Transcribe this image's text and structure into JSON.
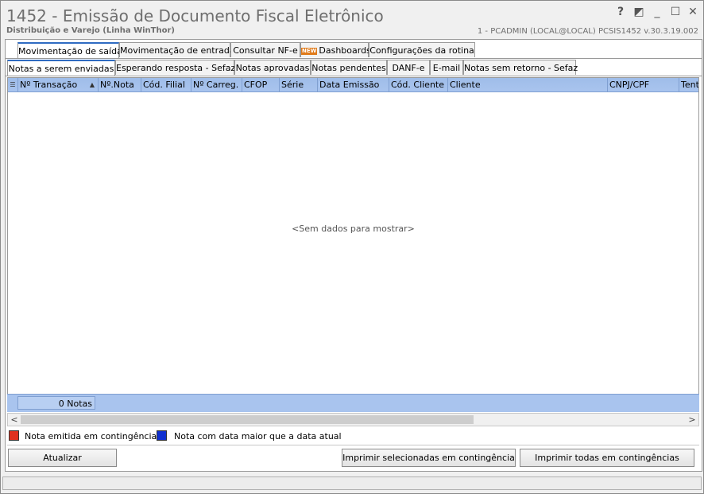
{
  "window": {
    "title": "1452 - Emissão de Documento Fiscal Eletrônico",
    "subtitle": "Distribuição e Varejo (Linha WinThor)",
    "user_info": "1 - PCADMIN (LOCAL@LOCAL)    PCSIS1452  v.30.3.19.002",
    "controls": {
      "help": "?",
      "restore": "◩",
      "minimize": "_",
      "maximize": "☐",
      "close": "✕"
    }
  },
  "main_tabs": [
    {
      "label": "Movimentação de saída",
      "active": true
    },
    {
      "label": "Movimentação de entrada",
      "active": false
    },
    {
      "label": "Consultar NF-e",
      "active": false
    },
    {
      "label": "Dashboards",
      "badge": "NEW",
      "active": false
    },
    {
      "label": "Configurações da rotina",
      "active": false
    }
  ],
  "sub_tabs": [
    {
      "label": "Notas a serem enviadas",
      "active": true
    },
    {
      "label": "Esperando resposta - Sefaz",
      "active": false
    },
    {
      "label": "Notas aprovadas",
      "active": false
    },
    {
      "label": "Notas pendentes",
      "active": false
    },
    {
      "label": "DANF-e",
      "active": false
    },
    {
      "label": "E-mail",
      "active": false
    },
    {
      "label": "Notas sem retorno - Sefaz",
      "active": false
    }
  ],
  "grid": {
    "columns": [
      "Nº Transação",
      "Nº.Nota",
      "Cód. Filial",
      "Nº Carreg.",
      "CFOP",
      "Série",
      "Data Emissão",
      "Cód. Cliente",
      "Cliente",
      "CNPJ/CPF",
      "Tenta"
    ],
    "sort_indicator": "▲",
    "empty_message": "<Sem dados para mostrar>",
    "count_label": "0 Notas"
  },
  "legend": [
    {
      "color": "#e0301e",
      "label": "Nota emitida em contingência"
    },
    {
      "color": "#1030d0",
      "label": "Nota com data maior que a data atual"
    }
  ],
  "buttons": {
    "refresh": "Atualizar",
    "print_selected": "Imprimir selecionadas em contingência",
    "print_all": "Imprimir todas em contingências"
  },
  "scroll": {
    "left": "<",
    "right": ">"
  }
}
